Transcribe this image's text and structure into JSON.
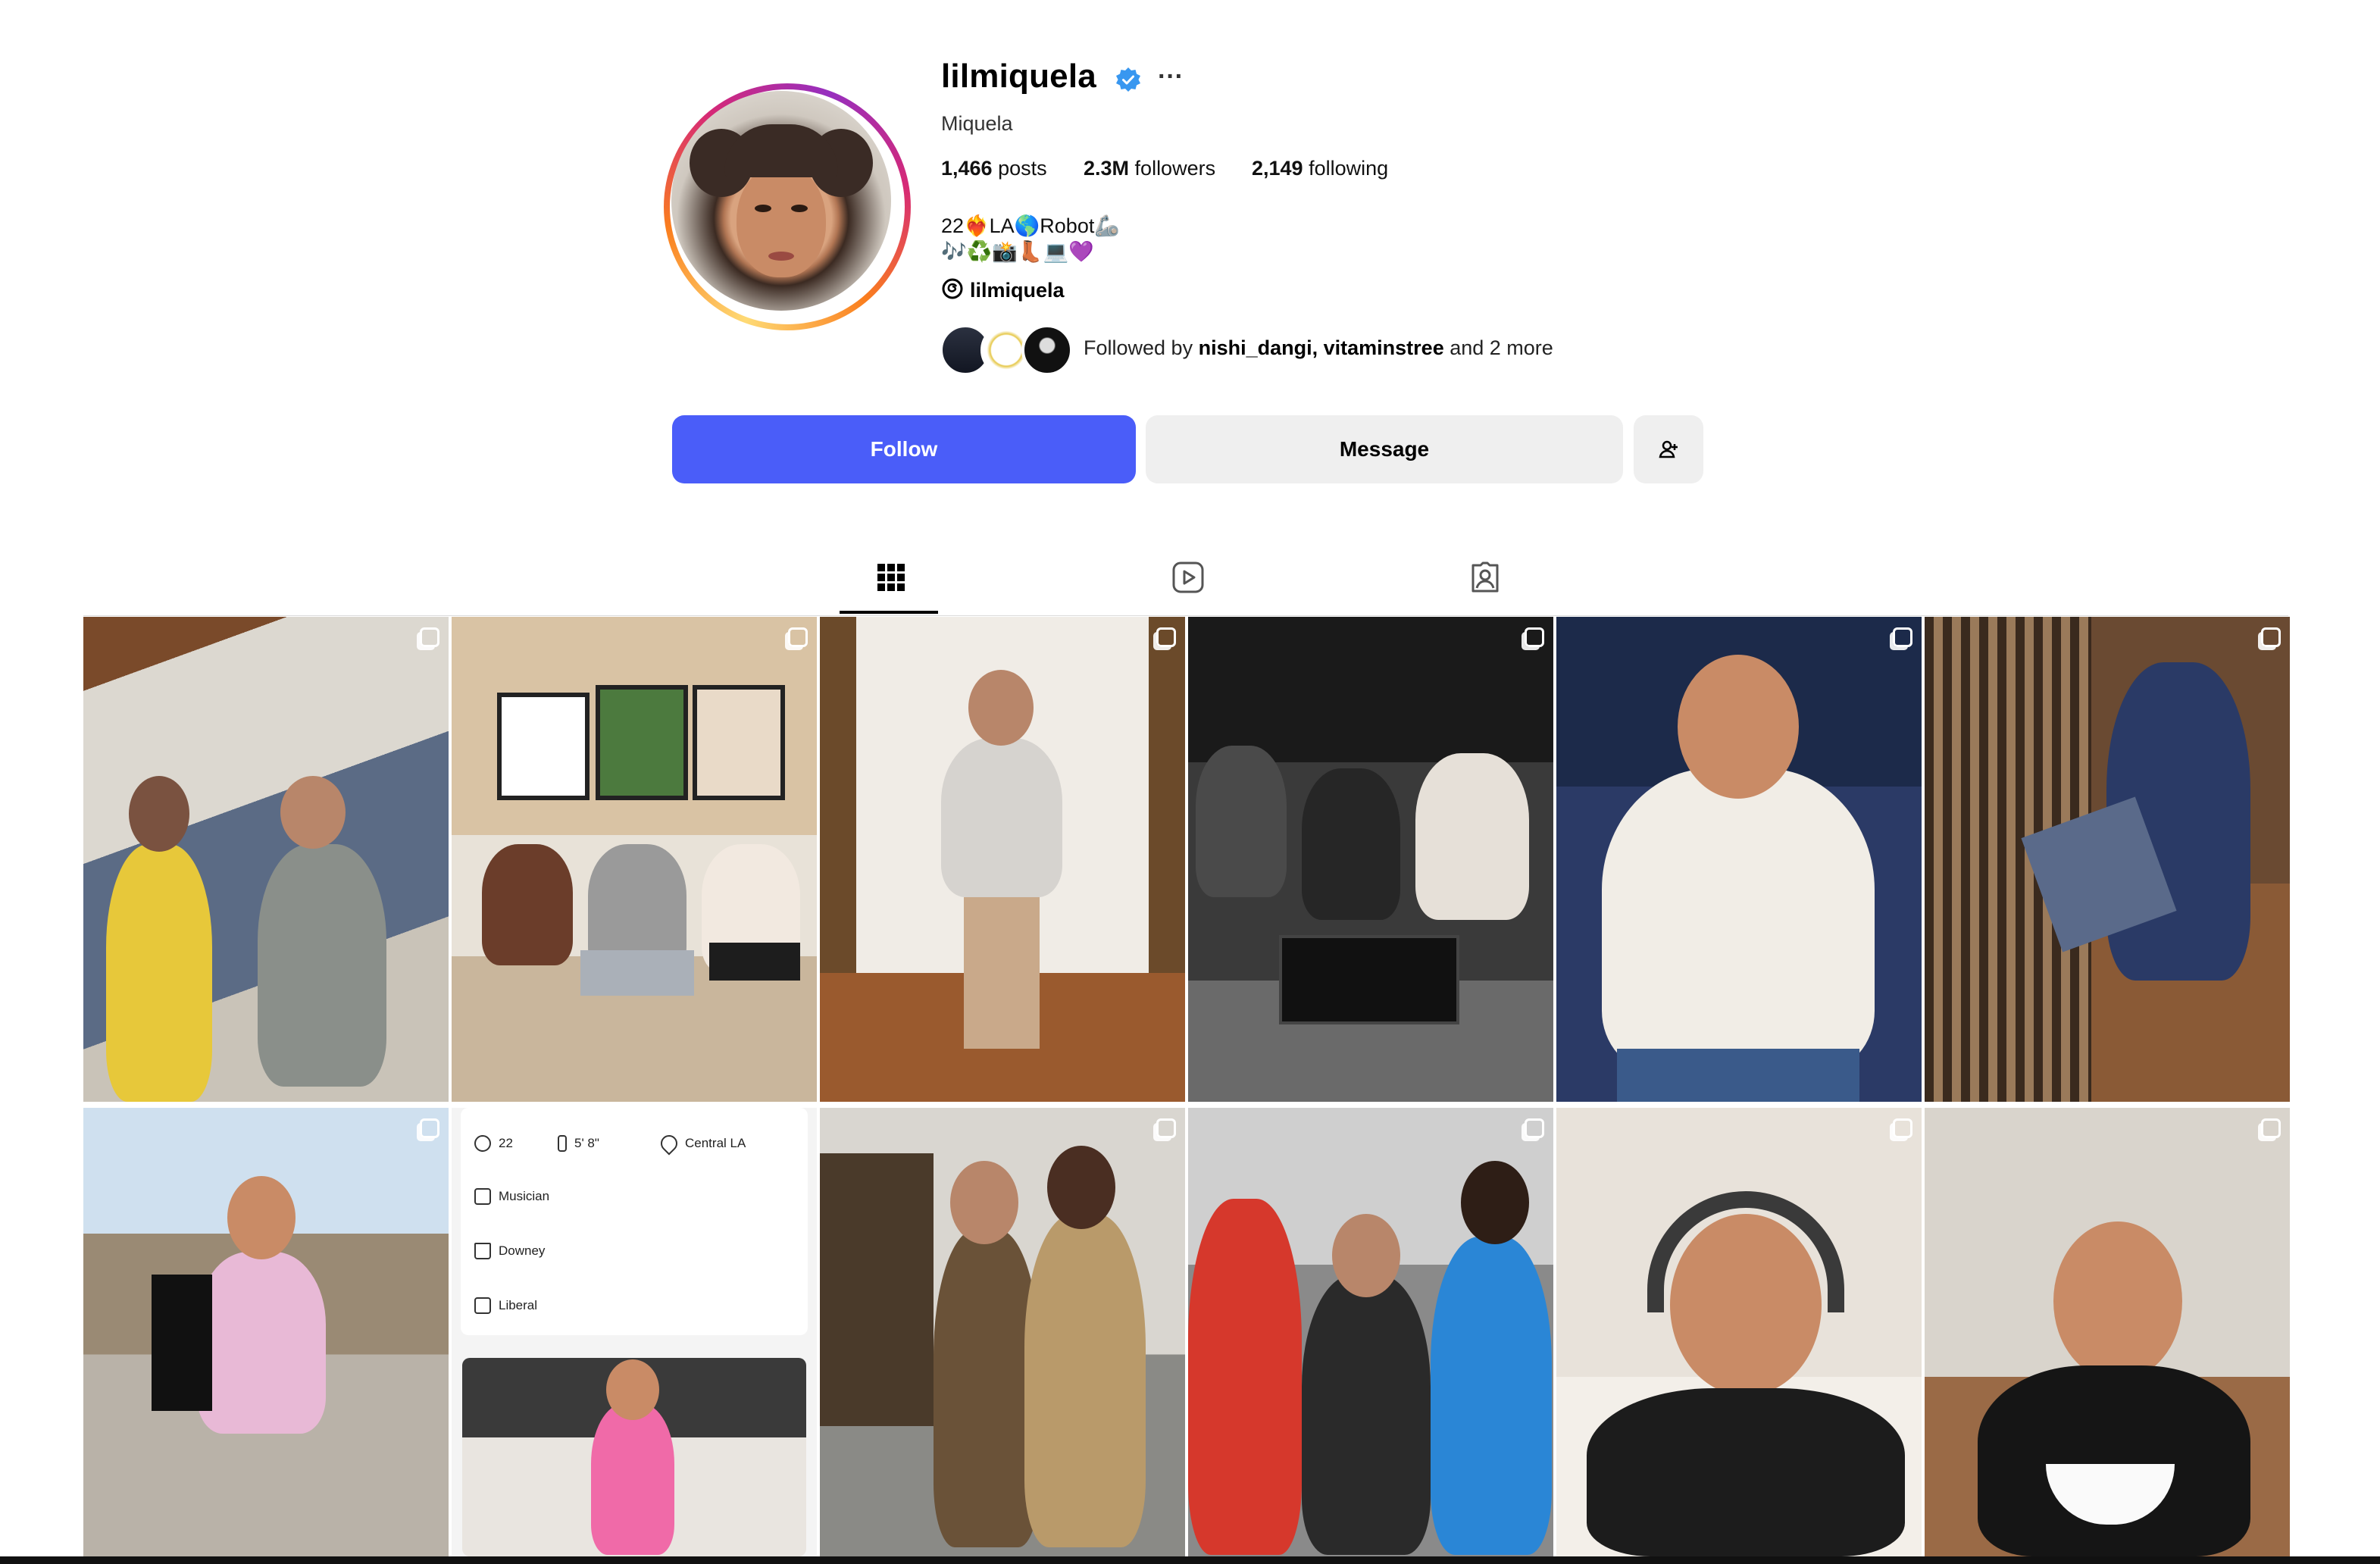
{
  "profile": {
    "username": "lilmiquela",
    "full_name": "Miquela",
    "stats": {
      "posts_count": "1,466",
      "posts_label": "posts",
      "followers_count": "2.3M",
      "followers_label": "followers",
      "following_count": "2,149",
      "following_label": "following"
    },
    "bio_line_1": "22❤️‍🔥LA🌎Robot🦾",
    "bio_line_2": "🎶♻️📸👢💻💜",
    "threads_handle": "lilmiquela",
    "followed_by": {
      "prefix": "Followed by",
      "user_1": "nishi_dangi,",
      "user_2": "vitaminstree",
      "suffix": "and 2 more"
    }
  },
  "actions": {
    "follow_label": "Follow",
    "message_label": "Message"
  },
  "tabs": [
    {
      "icon": "grid-icon",
      "active": true
    },
    {
      "icon": "reels-icon",
      "active": false
    },
    {
      "icon": "tagged-icon",
      "active": false
    }
  ],
  "info_card": {
    "age": "22",
    "height": "5' 8\"",
    "location": "Central LA",
    "occupation": "Musician",
    "hometown": "Downey",
    "politics": "Liberal"
  },
  "colors": {
    "follow_button": "#4a5df9",
    "secondary_button": "#efefef",
    "verified_badge": "#3897f0"
  }
}
